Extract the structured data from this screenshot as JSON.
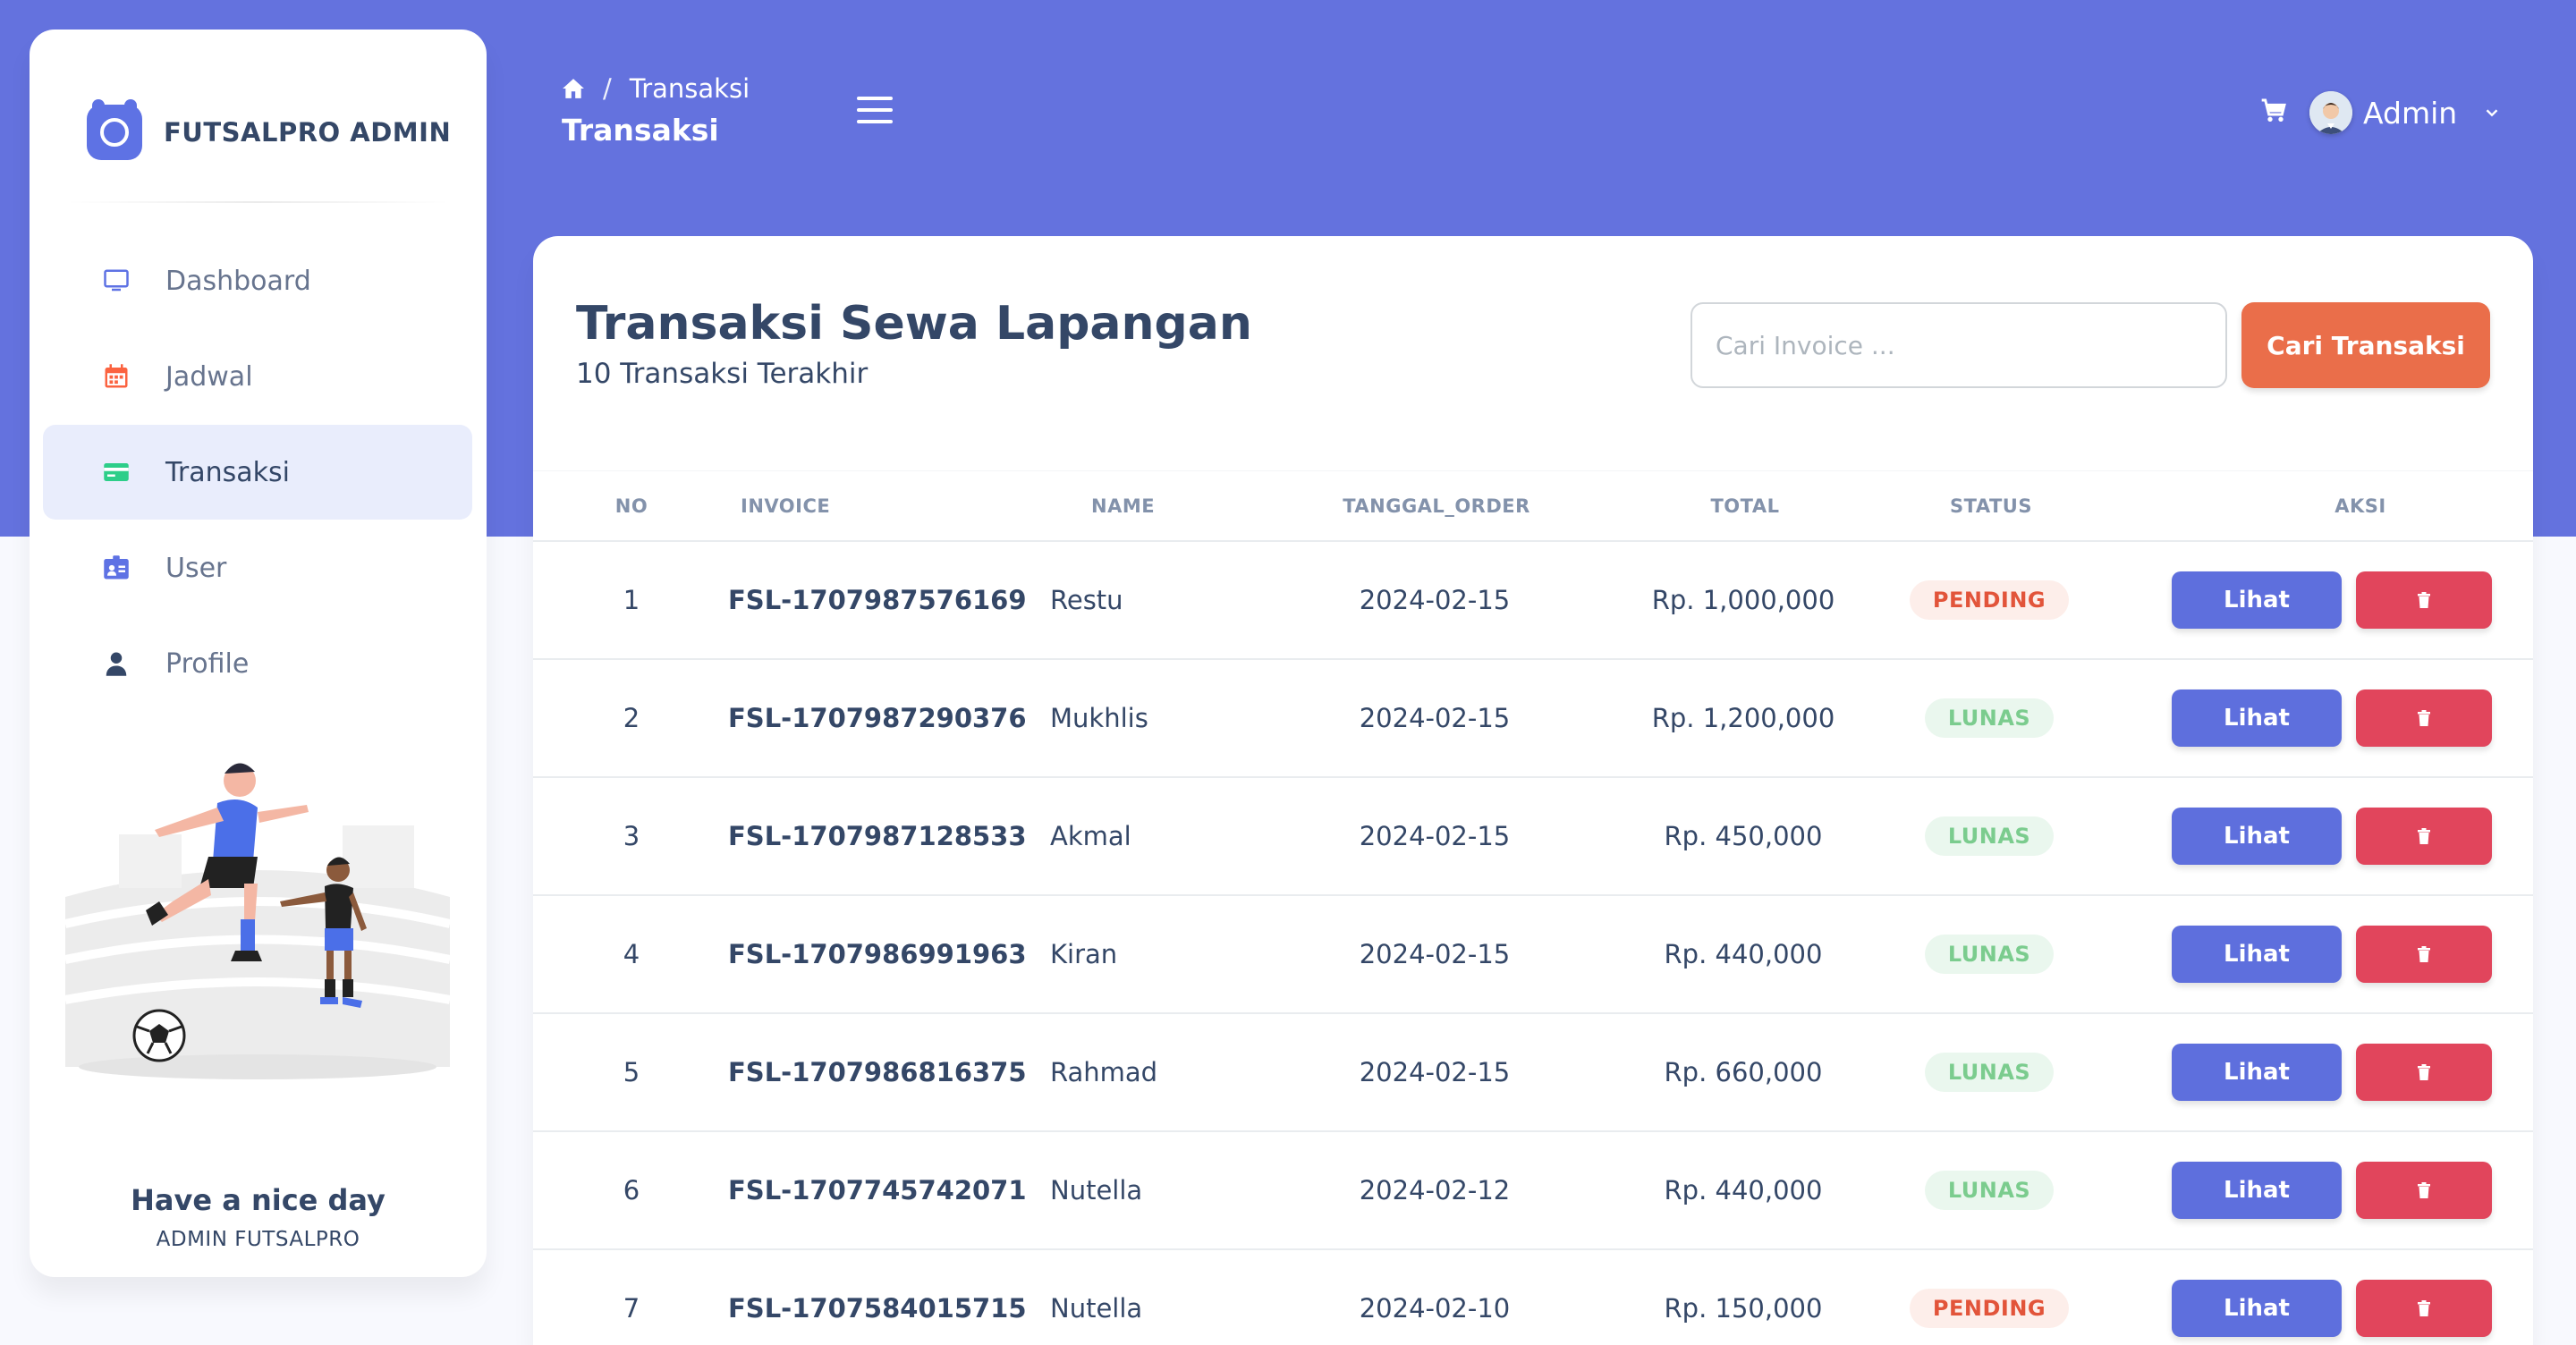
{
  "brand": {
    "name": "FUTSALPRO ADMIN"
  },
  "sidebar": {
    "items": [
      {
        "label": "Dashboard",
        "icon": "monitor-icon",
        "color": "#5e72e4"
      },
      {
        "label": "Jadwal",
        "icon": "calendar-icon",
        "color": "#fb6340"
      },
      {
        "label": "Transaksi",
        "icon": "credit-card-icon",
        "color": "#2dce89",
        "active": true
      },
      {
        "label": "User",
        "icon": "id-card-icon",
        "color": "#5e72e4"
      },
      {
        "label": "Profile",
        "icon": "user-icon",
        "color": "#344767"
      }
    ],
    "footer_title": "Have a nice day",
    "footer_subtitle": "ADMIN FUTSALPRO"
  },
  "header": {
    "breadcrumb_current": "Transaksi",
    "page_title": "Transaksi",
    "user_name": "Admin"
  },
  "main": {
    "title": "Transaksi Sewa Lapangan",
    "subtitle": "10 Transaksi Terakhir",
    "search_placeholder": "Cari Invoice ...",
    "search_button": "Cari Transaksi",
    "columns": [
      "NO",
      "INVOICE",
      "NAME",
      "TANGGAL_ORDER",
      "TOTAL",
      "STATUS",
      "AKSI"
    ],
    "rows": [
      {
        "no": "1",
        "invoice": "FSL-1707987576169",
        "name": "Restu",
        "date": "2024-02-15",
        "total": "Rp. 1,000,000",
        "status": "PENDING"
      },
      {
        "no": "2",
        "invoice": "FSL-1707987290376",
        "name": "Mukhlis",
        "date": "2024-02-15",
        "total": "Rp. 1,200,000",
        "status": "LUNAS"
      },
      {
        "no": "3",
        "invoice": "FSL-1707987128533",
        "name": "Akmal",
        "date": "2024-02-15",
        "total": "Rp. 450,000",
        "status": "LUNAS"
      },
      {
        "no": "4",
        "invoice": "FSL-1707986991963",
        "name": "Kiran",
        "date": "2024-02-15",
        "total": "Rp. 440,000",
        "status": "LUNAS"
      },
      {
        "no": "5",
        "invoice": "FSL-1707986816375",
        "name": "Rahmad",
        "date": "2024-02-15",
        "total": "Rp. 660,000",
        "status": "LUNAS"
      },
      {
        "no": "6",
        "invoice": "FSL-1707745742071",
        "name": "Nutella",
        "date": "2024-02-12",
        "total": "Rp. 440,000",
        "status": "LUNAS"
      },
      {
        "no": "7",
        "invoice": "FSL-1707584015715",
        "name": "Nutella",
        "date": "2024-02-10",
        "total": "Rp. 150,000",
        "status": "PENDING"
      }
    ],
    "view_label": "Lihat",
    "colors": {
      "primary": "#5e6fdd",
      "orange": "#ea6e4a",
      "danger": "#e1455c",
      "header_bg": "#6472de"
    }
  }
}
